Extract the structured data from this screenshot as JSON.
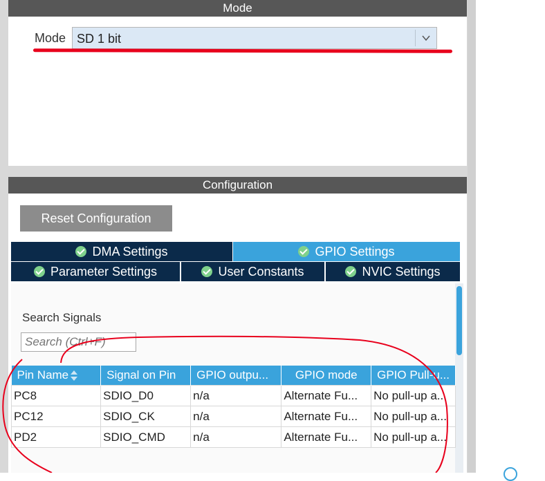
{
  "mode_section": {
    "header": "Mode",
    "label": "Mode",
    "selected_value": "SD 1 bit"
  },
  "config_section": {
    "header": "Configuration",
    "reset_button": "Reset Configuration",
    "tabs": [
      {
        "label": "DMA Settings",
        "active": false
      },
      {
        "label": "GPIO Settings",
        "active": true
      },
      {
        "label": "Parameter Settings",
        "active": false
      },
      {
        "label": "User Constants",
        "active": false
      },
      {
        "label": "NVIC Settings",
        "active": false
      }
    ],
    "search_label": "Search Signals",
    "search_placeholder": "Search (Ctrl+F)",
    "table": {
      "columns": [
        "Pin Name",
        "Signal on Pin",
        "GPIO outpu...",
        "GPIO mode",
        "GPIO Pull-u..."
      ],
      "rows": [
        [
          "PC8",
          "SDIO_D0",
          "n/a",
          "Alternate Fu...",
          "No pull-up a..."
        ],
        [
          "PC12",
          "SDIO_CK",
          "n/a",
          "Alternate Fu...",
          "No pull-up a..."
        ],
        [
          "PD2",
          "SDIO_CMD",
          "n/a",
          "Alternate Fu...",
          "No pull-up a..."
        ]
      ]
    }
  },
  "colors": {
    "header_bg": "#575757",
    "tab_dark": "#0b2a4a",
    "tab_active": "#3aa3dc",
    "annotation_red": "#e8001c"
  },
  "icons": [
    "chevron-down-icon",
    "check-circle-icon",
    "sort-icon"
  ]
}
